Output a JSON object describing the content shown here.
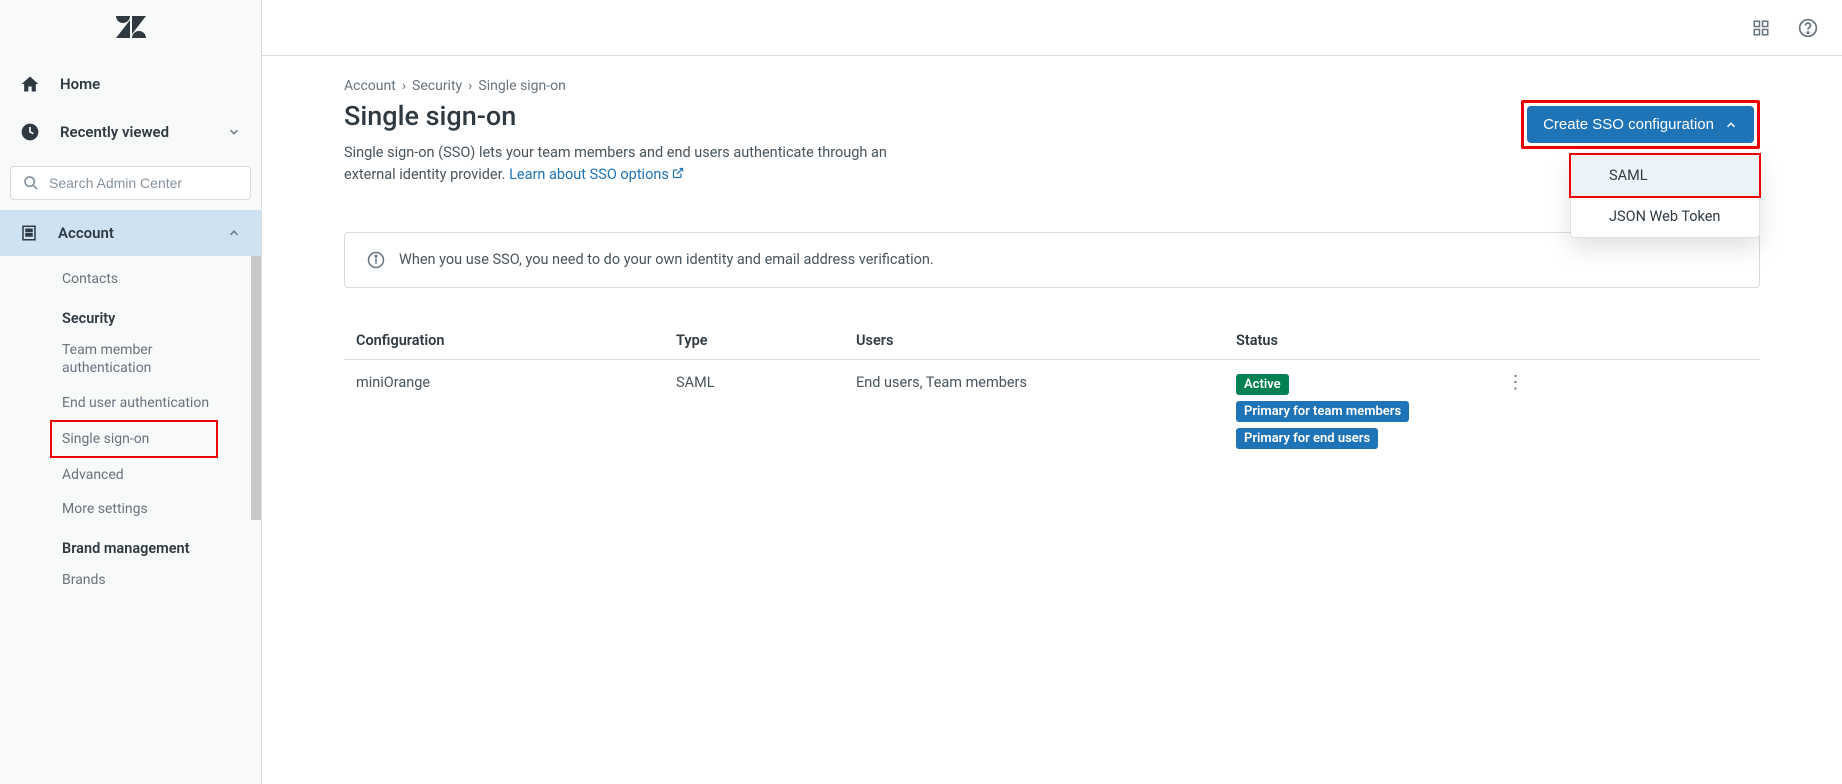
{
  "sidebar": {
    "nav": {
      "home": "Home",
      "recent": "Recently viewed"
    },
    "search": {
      "placeholder": "Search Admin Center"
    },
    "section": {
      "account": "Account"
    },
    "items": {
      "contacts": "Contacts",
      "security_heading": "Security",
      "team_member_auth": "Team member authentication",
      "end_user_auth": "End user authentication",
      "single_sign_on": "Single sign-on",
      "advanced": "Advanced",
      "more_settings": "More settings",
      "brand_heading": "Brand management",
      "brands": "Brands"
    }
  },
  "breadcrumb": {
    "a": "Account",
    "b": "Security",
    "c": "Single sign-on"
  },
  "page": {
    "title": "Single sign-on",
    "subtitle_1": "Single sign-on (SSO) lets your team members and end users authenticate through an external identity provider. ",
    "learn_link": "Learn about SSO options",
    "create_btn": "Create SSO configuration",
    "dropdown": {
      "saml": "SAML",
      "jwt": "JSON Web Token"
    },
    "info": "When you use SSO, you need to do your own identity and email address verification."
  },
  "table": {
    "headers": {
      "config": "Configuration",
      "type": "Type",
      "users": "Users",
      "status": "Status"
    },
    "row1": {
      "config": "miniOrange",
      "type": "SAML",
      "users": "End users, Team members",
      "badge_active": "Active",
      "badge_primary_team": "Primary for team members",
      "badge_primary_end": "Primary for end users"
    }
  }
}
